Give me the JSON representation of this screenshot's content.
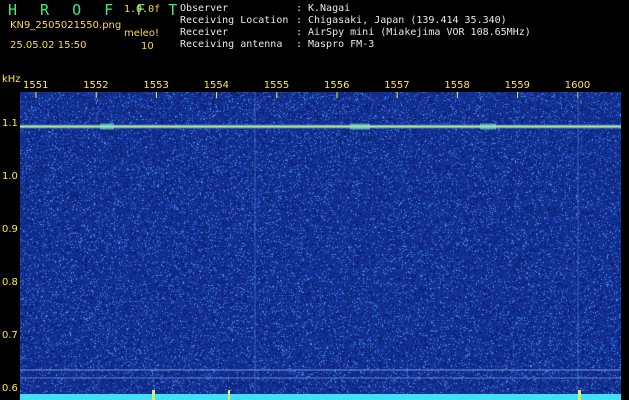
{
  "header": {
    "brand": "H R O F F T",
    "version": "1.0.0f",
    "filename": "KN9_2505021550.png",
    "datetime": "25.05.02 15:50",
    "meleo_label": "meleo!",
    "meleo_value": "10"
  },
  "metadata": [
    {
      "label": "Observer",
      "sep": ":",
      "value": "K.Nagai"
    },
    {
      "label": "Receiving Location",
      "sep": ":",
      "value": "Chigasaki, Japan (139.414 35.340)"
    },
    {
      "label": "Receiver",
      "sep": ":",
      "value": "AirSpy mini (Miakejima VOR 108.65MHz)"
    },
    {
      "label": "Receiving antenna",
      "sep": ":",
      "value": "Maspro FM-3"
    }
  ],
  "chart_data": {
    "type": "heatmap",
    "ylabel": "kHz",
    "x_ticks": [
      "1551",
      "1552",
      "1553",
      "1554",
      "1555",
      "1556",
      "1557",
      "1558",
      "1559",
      "1600"
    ],
    "y_ticks": [
      1.1,
      1.0,
      0.9,
      0.8,
      0.7,
      0.6
    ],
    "ylim": [
      0.58,
      1.16
    ],
    "signal_band_khz": 1.095,
    "colors": {
      "background": "#15349a",
      "noise": "#3a7ce8",
      "signal": "#d8f060",
      "floor": "#40e0f8",
      "tick": "#ffe84a"
    }
  }
}
